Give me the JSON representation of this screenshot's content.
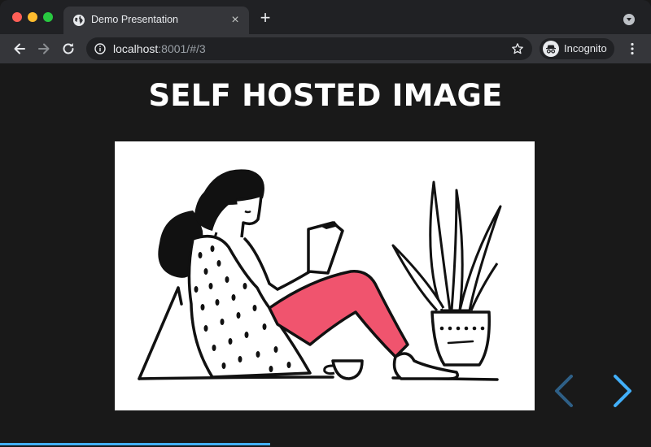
{
  "window": {
    "tab_title": "Demo Presentation"
  },
  "toolbar": {
    "url_host": "localhost",
    "url_rest": ":8001/#/3",
    "incognito_label": "Incognito"
  },
  "slide": {
    "title": "SELF HOSTED IMAGE",
    "progress": 0.415
  },
  "icons": {
    "close": "×",
    "new_tab": "+"
  },
  "colors": {
    "accent": "#42affa",
    "pink": "#f0546e",
    "background": "#191919"
  }
}
